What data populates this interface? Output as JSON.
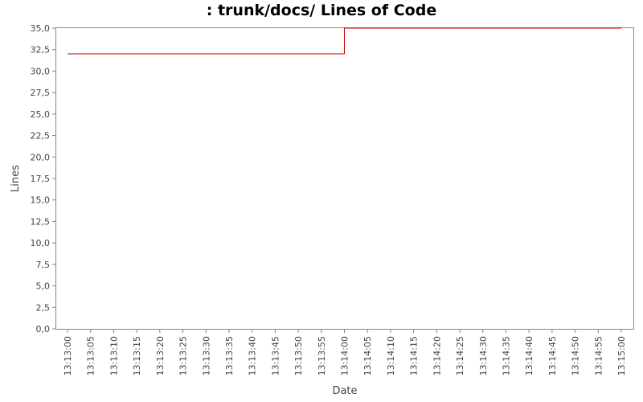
{
  "chart_data": {
    "type": "line",
    "title": ": trunk/docs/ Lines of Code",
    "xlabel": "Date",
    "ylabel": "Lines",
    "x_ticks": [
      "13:13:00",
      "13:13:05",
      "13:13:10",
      "13:13:15",
      "13:13:20",
      "13:13:25",
      "13:13:30",
      "13:13:35",
      "13:13:40",
      "13:13:45",
      "13:13:50",
      "13:13:55",
      "13:14:00",
      "13:14:05",
      "13:14:10",
      "13:14:15",
      "13:14:20",
      "13:14:25",
      "13:14:30",
      "13:14:35",
      "13:14:40",
      "13:14:45",
      "13:14:50",
      "13:14:55",
      "13:15:00"
    ],
    "y_ticks": [
      "0,0",
      "2,5",
      "5,0",
      "7,5",
      "10,0",
      "12,5",
      "15,0",
      "17,5",
      "20,0",
      "22,5",
      "25,0",
      "27,5",
      "30,0",
      "32,5",
      "35,0"
    ],
    "ylim": [
      0,
      35
    ],
    "xlim": [
      "13:13:00",
      "13:15:00"
    ],
    "step": true,
    "series": [
      {
        "color": "#cc0000",
        "x": [
          "13:13:00",
          "13:14:00",
          "13:15:00"
        ],
        "y": [
          32,
          35,
          35
        ]
      }
    ],
    "grid": false,
    "legend": false
  }
}
